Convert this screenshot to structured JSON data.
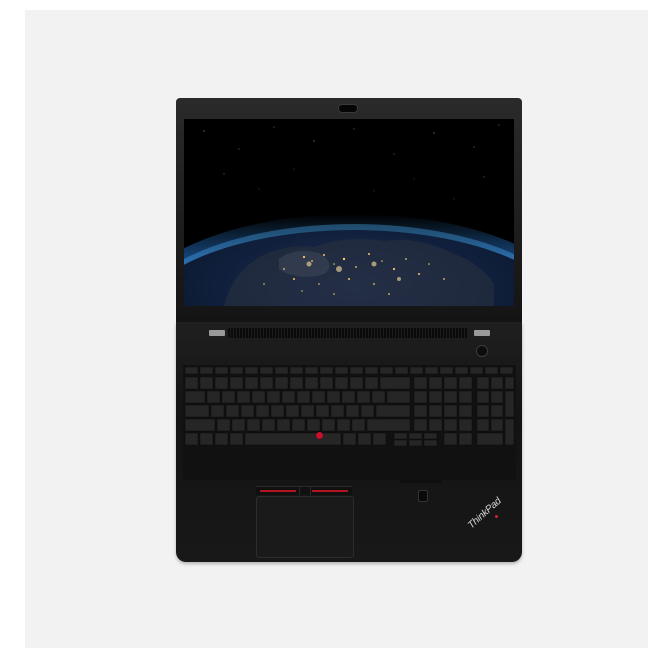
{
  "laptop": {
    "brand_text": "ThinkPad",
    "brand_accent_color": "#c8102e",
    "body_color": "#161616",
    "screen_wallpaper": "earth-at-night-europe"
  },
  "background_color": "#f2f2f2"
}
